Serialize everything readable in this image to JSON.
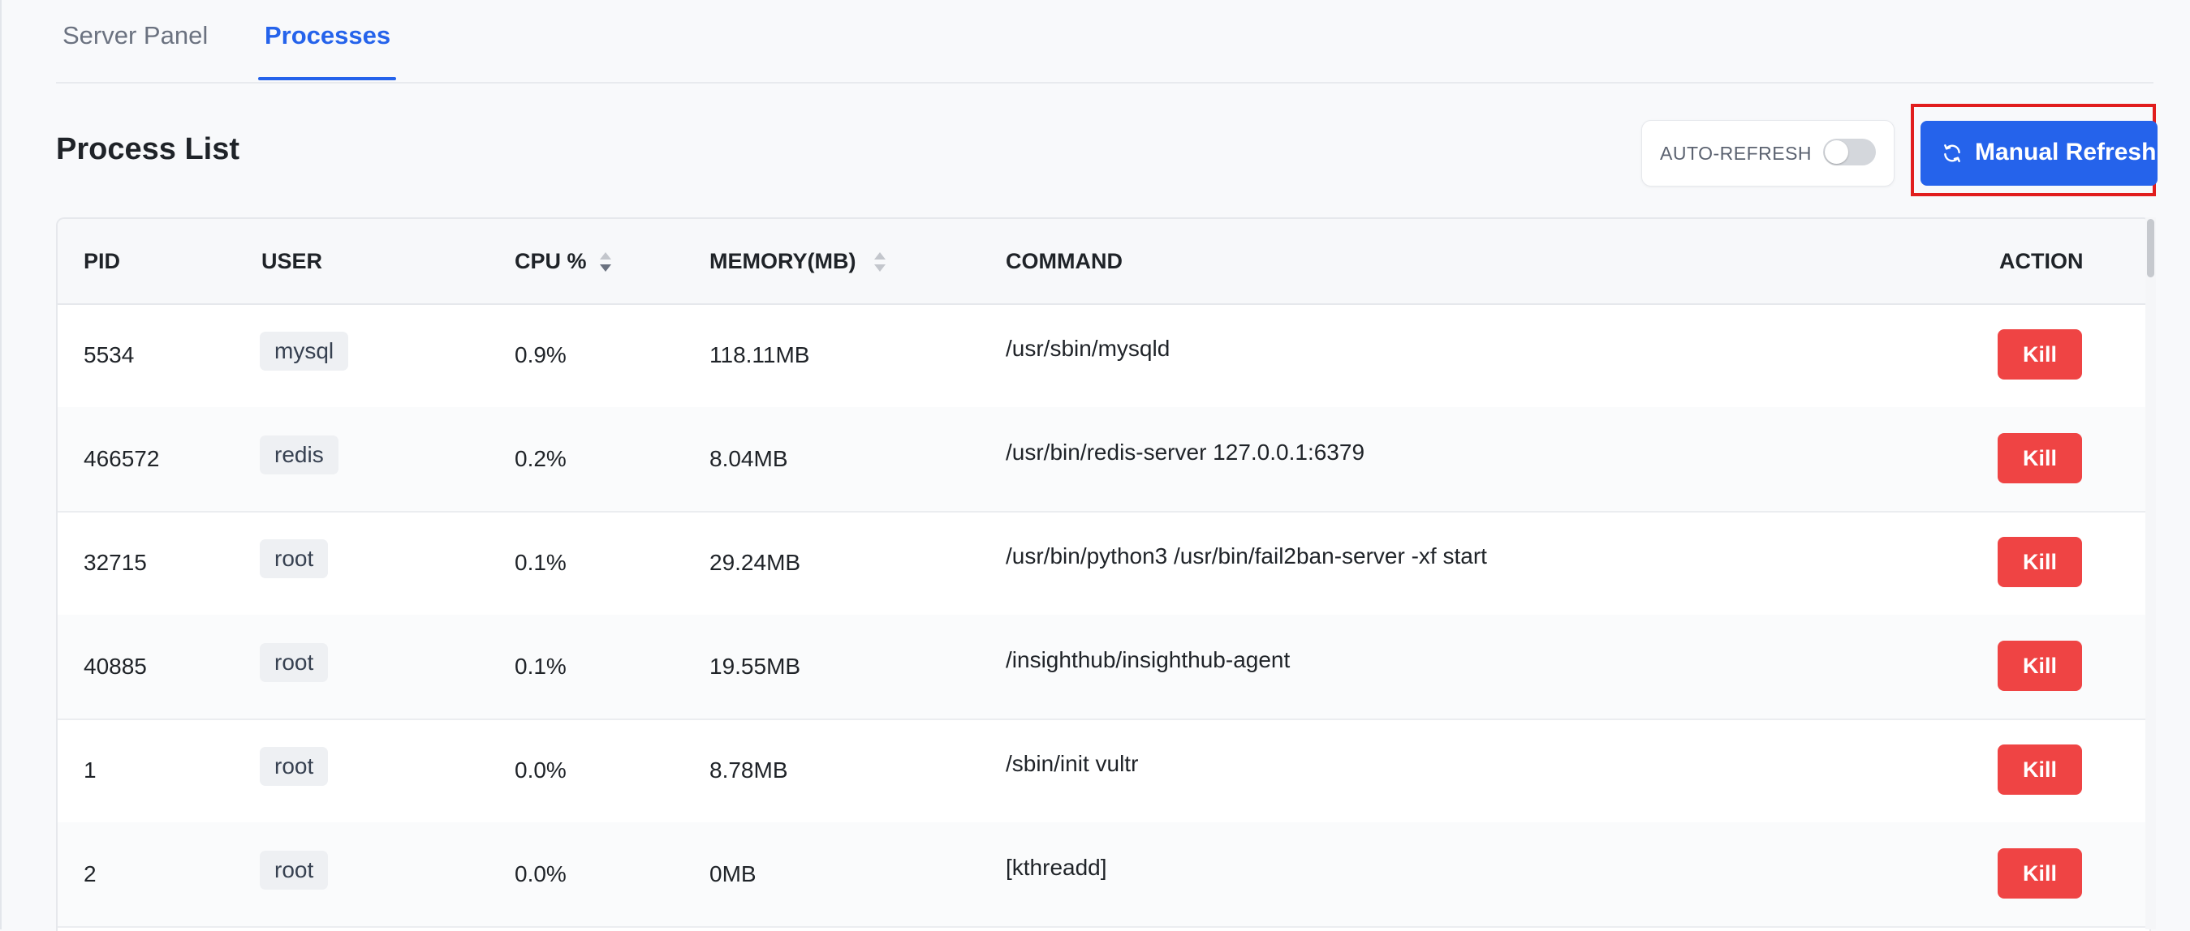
{
  "tabs": [
    {
      "label": "Server Panel",
      "active": false
    },
    {
      "label": "Processes",
      "active": true
    }
  ],
  "header": {
    "title": "Process List",
    "auto_refresh_label": "AUTO-REFRESH",
    "auto_refresh_on": false,
    "manual_refresh_label": "Manual Refresh",
    "refresh_icon": "refresh-icon"
  },
  "table": {
    "columns": {
      "pid": "PID",
      "user": "USER",
      "cpu": "CPU %",
      "memory": "MEMORY(MB)",
      "command": "COMMAND",
      "action": "ACTION"
    },
    "kill_label": "Kill",
    "rows": [
      {
        "pid": "5534",
        "user": "mysql",
        "cpu": "0.9%",
        "memory": "118.11MB",
        "command": "/usr/sbin/mysqld"
      },
      {
        "pid": "466572",
        "user": "redis",
        "cpu": "0.2%",
        "memory": "8.04MB",
        "command": "/usr/bin/redis-server 127.0.0.1:6379"
      },
      {
        "pid": "32715",
        "user": "root",
        "cpu": "0.1%",
        "memory": "29.24MB",
        "command": "/usr/bin/python3 /usr/bin/fail2ban-server -xf start"
      },
      {
        "pid": "40885",
        "user": "root",
        "cpu": "0.1%",
        "memory": "19.55MB",
        "command": "/insighthub/insighthub-agent"
      },
      {
        "pid": "1",
        "user": "root",
        "cpu": "0.0%",
        "memory": "8.78MB",
        "command": "/sbin/init vultr"
      },
      {
        "pid": "2",
        "user": "root",
        "cpu": "0.0%",
        "memory": "0MB",
        "command": "[kthreadd]"
      }
    ]
  },
  "colors": {
    "accent": "#2563eb",
    "danger": "#ef4444",
    "highlight": "#e11d1d"
  }
}
